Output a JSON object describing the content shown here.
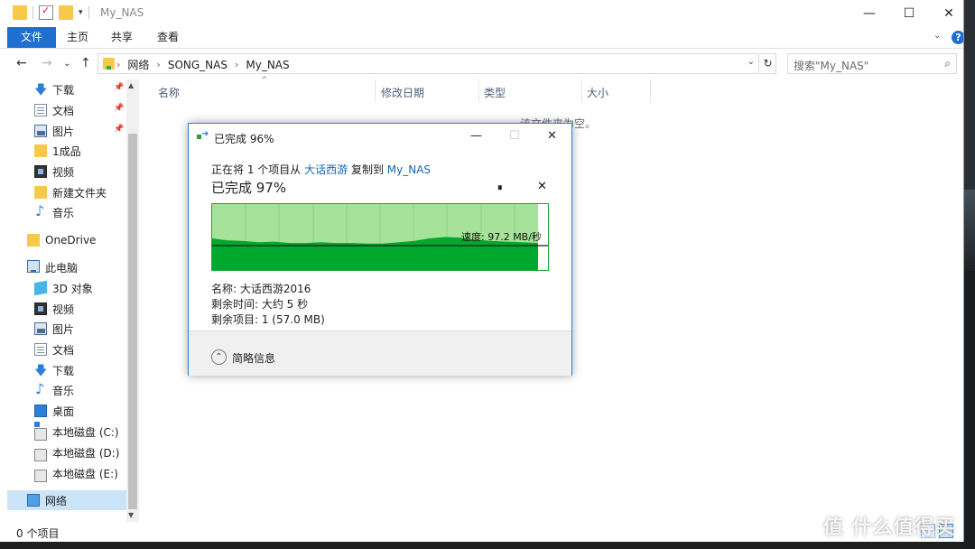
{
  "window": {
    "title": "My_NAS",
    "min_glyph": "—",
    "max_glyph": "☐",
    "close_glyph": "✕"
  },
  "ribbon": {
    "tabs": [
      "文件",
      "主页",
      "共享",
      "查看"
    ],
    "help": "?",
    "expand_caret": "⌄"
  },
  "nav": {
    "back": "←",
    "forward": "→",
    "recent": "⌄",
    "up": "↑"
  },
  "address": {
    "crumbs": [
      "网络",
      "SONG_NAS",
      "My_NAS"
    ],
    "search_placeholder": "搜索\"My_NAS\"",
    "refresh": "↻"
  },
  "sidebar": {
    "items": [
      {
        "label": "下载",
        "icon": "download-icon",
        "pinned": true
      },
      {
        "label": "文档",
        "icon": "document-icon",
        "pinned": true
      },
      {
        "label": "图片",
        "icon": "picture-icon",
        "pinned": true
      },
      {
        "label": "1成品",
        "icon": "folder-icon",
        "pinned": false
      },
      {
        "label": "视频",
        "icon": "video-icon",
        "pinned": false
      },
      {
        "label": "新建文件夹",
        "icon": "folder-icon",
        "pinned": false
      },
      {
        "label": "音乐",
        "icon": "music-icon",
        "pinned": false
      },
      {
        "label": "OneDrive",
        "icon": "onedrive-icon",
        "pinned": false
      },
      {
        "label": "此电脑",
        "icon": "this-pc-icon",
        "pinned": false
      },
      {
        "label": "3D 对象",
        "icon": "3d-objects-icon",
        "pinned": false
      },
      {
        "label": "视频",
        "icon": "video-icon",
        "pinned": false
      },
      {
        "label": "图片",
        "icon": "picture-icon",
        "pinned": false
      },
      {
        "label": "文档",
        "icon": "document-icon",
        "pinned": false
      },
      {
        "label": "下载",
        "icon": "download-icon",
        "pinned": false
      },
      {
        "label": "音乐",
        "icon": "music-icon",
        "pinned": false
      },
      {
        "label": "桌面",
        "icon": "desktop-icon",
        "pinned": false
      },
      {
        "label": "本地磁盘 (C:)",
        "icon": "drive-c-icon",
        "pinned": false
      },
      {
        "label": "本地磁盘 (D:)",
        "icon": "drive-icon",
        "pinned": false
      },
      {
        "label": "本地磁盘 (E:)",
        "icon": "drive-icon",
        "pinned": false
      },
      {
        "label": "网络",
        "icon": "network-icon",
        "pinned": false,
        "selected": true
      }
    ]
  },
  "columns": [
    "名称",
    "修改日期",
    "类型",
    "大小"
  ],
  "content": {
    "empty_message": "该文件夹为空。"
  },
  "status": {
    "item_count": "0 个项目"
  },
  "dialog": {
    "title": "已完成 96%",
    "line1_prefix": "正在将 1 个项目从",
    "source": "大话西游",
    "line1_mid": "复制到",
    "destination": "My_NAS",
    "percent_text": "已完成 97%",
    "pause_glyph": "⏸",
    "cancel_glyph": "✕",
    "speed_label": "速度: 97.2 MB/秒",
    "name_line": "名称: 大话西游2016",
    "time_line": "剩余时间: 大约 5 秒",
    "items_line": "剩余项目: 1 (57.0 MB)",
    "details_label": "简略信息",
    "details_glyph": "⌃",
    "progress_fraction": 0.97,
    "colors": {
      "fill": "#00a82d",
      "graph_bg": "#a6e29a",
      "line": "#1a1a1a"
    }
  },
  "watermark": "值 什么值得买",
  "colors": {
    "accent": "#1e6fcf",
    "selected": "#cce4f7"
  }
}
